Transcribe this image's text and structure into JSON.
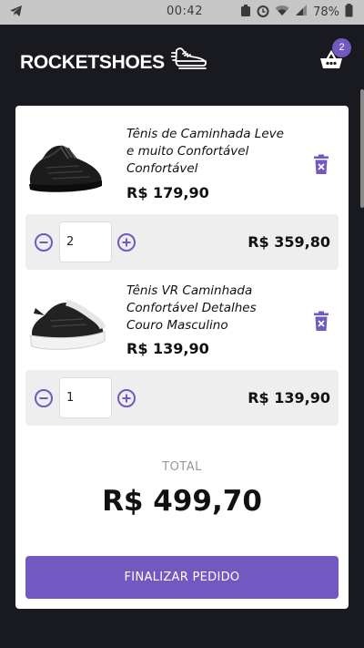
{
  "status_bar": {
    "time": "00:42",
    "battery": "78%"
  },
  "header": {
    "brand": "ROCKETSHOES",
    "cart_count": "2",
    "colors": {
      "background": "#191920",
      "accent": "#7159c1"
    }
  },
  "cart": {
    "items": [
      {
        "title": "Tênis de Caminhada Leve e muito Confortável Confortável",
        "price": "R$ 179,90",
        "quantity": "2",
        "subtotal": "R$ 359,80"
      },
      {
        "title": "Tênis VR Caminhada Confortável Detalhes Couro Masculino",
        "price": "R$ 139,90",
        "quantity": "1",
        "subtotal": "R$ 139,90"
      }
    ],
    "total_label": "TOTAL",
    "total_value": "R$ 499,70",
    "checkout_label": "FINALIZAR PEDIDO"
  },
  "icons": {
    "cart": "basket-icon",
    "delete": "trash-icon",
    "decrement": "minus-circle-icon",
    "increment": "plus-circle-icon",
    "brand": "running-shoe-icon"
  }
}
